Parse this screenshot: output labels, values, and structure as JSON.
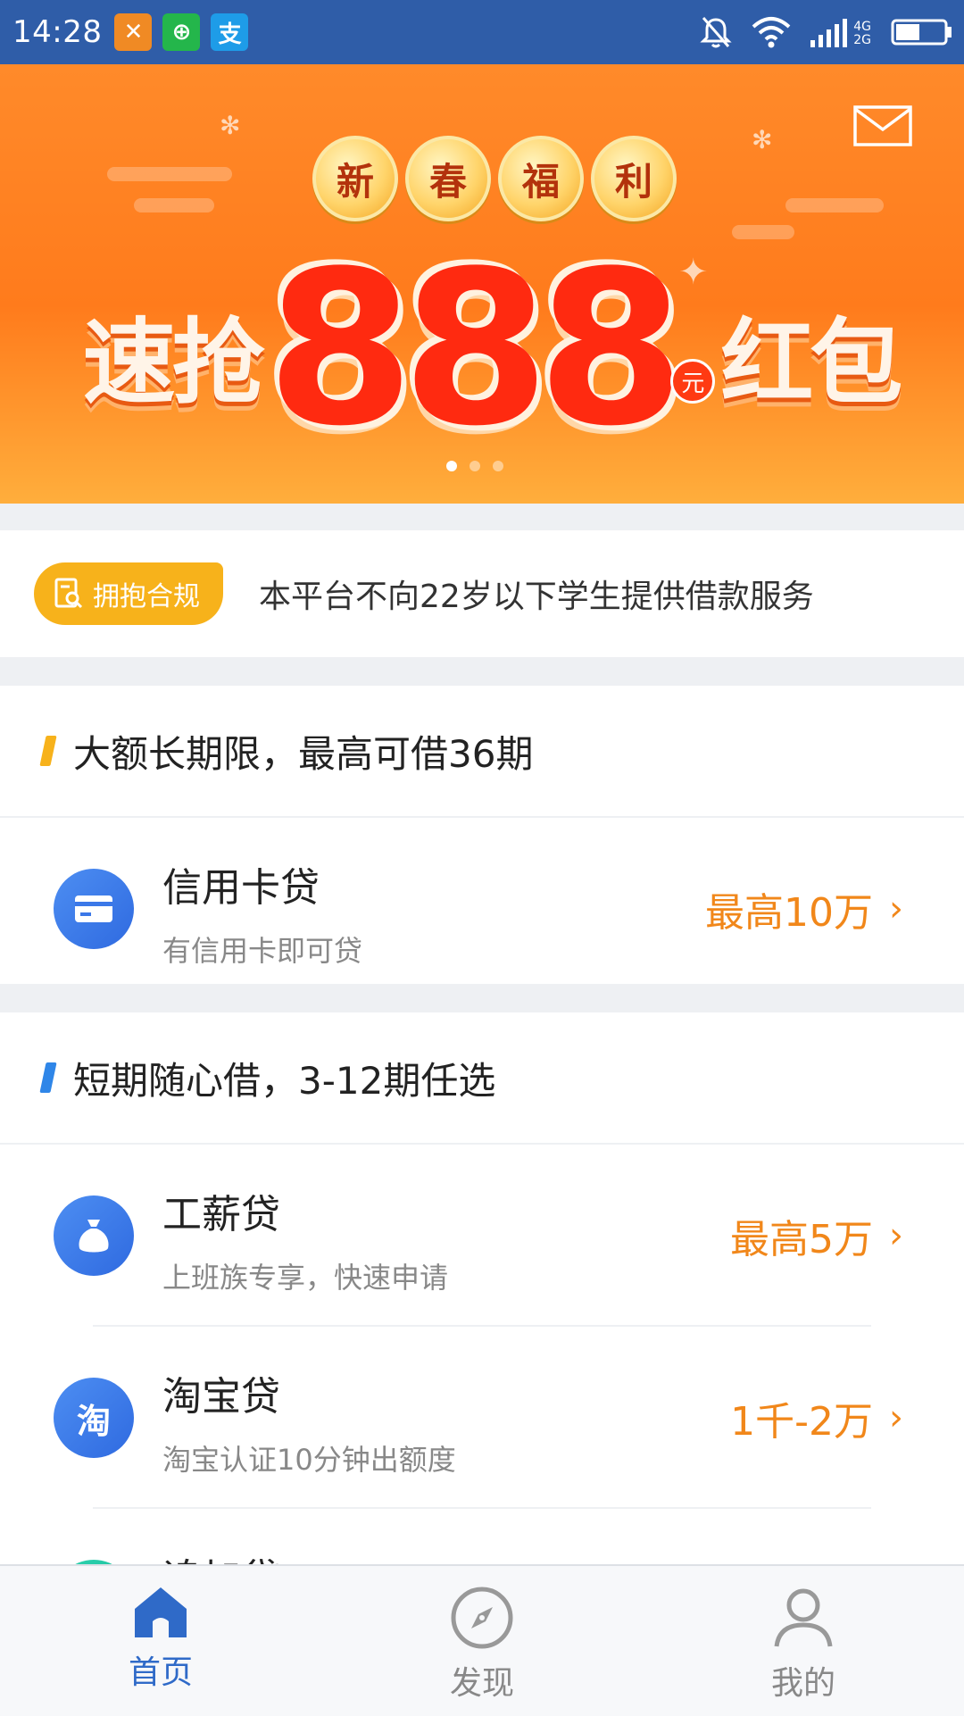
{
  "status_bar": {
    "time": "14:28",
    "net_top": "4G",
    "net_bottom": "2G"
  },
  "banner": {
    "coins": [
      "新",
      "春",
      "福",
      "利"
    ],
    "left_word": "速抢",
    "amount": "888",
    "yuan": "元",
    "right_word": "红包"
  },
  "notice": {
    "badge": "拥抱合规",
    "text": "本平台不向22岁以下学生提供借款服务"
  },
  "sections": [
    {
      "title": "大额长期限，最高可借36期",
      "accent": "#f7b21b",
      "items": [
        {
          "name": "信用卡贷",
          "desc": "有信用卡即可贷",
          "amount": "最高10万",
          "icon": "credit-card-icon"
        }
      ]
    },
    {
      "title": "短期随心借，3-12期任选",
      "accent": "#2f86e8",
      "items": [
        {
          "name": "工薪贷",
          "desc": "上班族专享，快速申请",
          "amount": "最高5万",
          "icon": "money-bag-icon"
        },
        {
          "name": "淘宝贷",
          "desc": "淘宝认证10分钟出额度",
          "amount": "1千-2万",
          "icon": "taobao-icon",
          "icon_text": "淘"
        },
        {
          "name": "追加贷",
          "desc": "",
          "amount": "",
          "icon": "add-icon"
        }
      ]
    }
  ],
  "chevron": "›",
  "nav": {
    "home": "首页",
    "discover": "发现",
    "mine": "我的"
  },
  "colors": {
    "status_bar": "#2f5da8",
    "accent_orange": "#f1871a",
    "primary_blue": "#2f6ac8"
  }
}
